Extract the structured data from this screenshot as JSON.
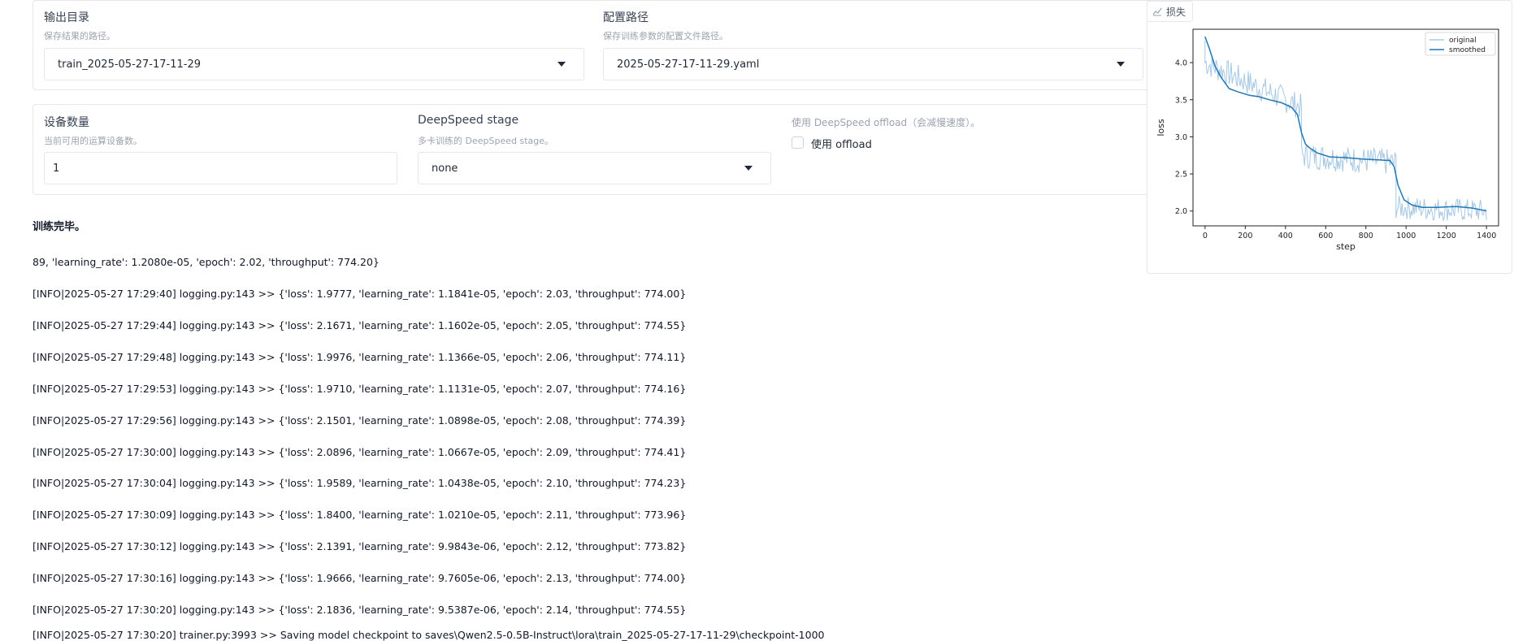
{
  "output_section": {
    "output_dir": {
      "label": "输出目录",
      "hint": "保存结果的路径。",
      "value": "train_2025-05-27-17-11-29"
    },
    "config_path": {
      "label": "配置路径",
      "hint": "保存训练参数的配置文件路径。",
      "value": "2025-05-27-17-11-29.yaml"
    }
  },
  "device_section": {
    "device_count": {
      "label": "设备数量",
      "hint": "当前可用的运算设备数。",
      "value": "1"
    },
    "ds_stage": {
      "label": "DeepSpeed stage",
      "hint": "多卡训练的 DeepSpeed stage。",
      "value": "none"
    },
    "ds_offload": {
      "hint": "使用 DeepSpeed offload（会减慢速度）。",
      "label": "使用 offload",
      "checked": false
    }
  },
  "status_text": "训练完毕。",
  "log_lines": [
    "89, 'learning_rate': 1.2080e-05, 'epoch': 2.02, 'throughput': 774.20}",
    "[INFO|2025-05-27 17:29:40] logging.py:143 >> {'loss': 1.9777, 'learning_rate': 1.1841e-05, 'epoch': 2.03, 'throughput': 774.00}",
    "[INFO|2025-05-27 17:29:44] logging.py:143 >> {'loss': 2.1671, 'learning_rate': 1.1602e-05, 'epoch': 2.05, 'throughput': 774.55}",
    "[INFO|2025-05-27 17:29:48] logging.py:143 >> {'loss': 1.9976, 'learning_rate': 1.1366e-05, 'epoch': 2.06, 'throughput': 774.11}",
    "[INFO|2025-05-27 17:29:53] logging.py:143 >> {'loss': 1.9710, 'learning_rate': 1.1131e-05, 'epoch': 2.07, 'throughput': 774.16}",
    "[INFO|2025-05-27 17:29:56] logging.py:143 >> {'loss': 2.1501, 'learning_rate': 1.0898e-05, 'epoch': 2.08, 'throughput': 774.39}",
    "[INFO|2025-05-27 17:30:00] logging.py:143 >> {'loss': 2.0896, 'learning_rate': 1.0667e-05, 'epoch': 2.09, 'throughput': 774.41}",
    "[INFO|2025-05-27 17:30:04] logging.py:143 >> {'loss': 1.9589, 'learning_rate': 1.0438e-05, 'epoch': 2.10, 'throughput': 774.23}",
    "[INFO|2025-05-27 17:30:09] logging.py:143 >> {'loss': 1.8400, 'learning_rate': 1.0210e-05, 'epoch': 2.11, 'throughput': 773.96}",
    "[INFO|2025-05-27 17:30:12] logging.py:143 >> {'loss': 2.1391, 'learning_rate': 9.9843e-06, 'epoch': 2.12, 'throughput': 773.82}",
    "[INFO|2025-05-27 17:30:16] logging.py:143 >> {'loss': 1.9666, 'learning_rate': 9.7605e-06, 'epoch': 2.13, 'throughput': 774.00}",
    "[INFO|2025-05-27 17:30:20] logging.py:143 >> {'loss': 2.1836, 'learning_rate': 9.5387e-06, 'epoch': 2.14, 'throughput': 774.55}",
    "[INFO|2025-05-27 17:30:20] trainer.py:3993 >> Saving model checkpoint to saves\\Qwen2.5-0.5B-Instruct\\lora\\train_2025-05-27-17-11-29\\checkpoint-1000"
  ],
  "plot_tab": {
    "label": "损失",
    "icon": "line-chart-icon"
  },
  "chart_data": {
    "type": "line",
    "title": "",
    "xlabel": "step",
    "ylabel": "loss",
    "xlim": [
      -60,
      1460
    ],
    "ylim": [
      1.8,
      4.45
    ],
    "xticks": [
      0,
      200,
      400,
      600,
      800,
      1000,
      1200,
      1400
    ],
    "yticks": [
      2.0,
      2.5,
      3.0,
      3.5,
      4.0
    ],
    "legend_position": "top-right",
    "series": [
      {
        "name": "original",
        "color": "#a6c8e4",
        "style": "noisy",
        "segments": [
          {
            "x0": 0,
            "x1": 480,
            "y0": 4.0,
            "y1": 3.4,
            "amp": 0.18
          },
          {
            "x0": 480,
            "x1": 950,
            "y0": 2.75,
            "y1": 2.65,
            "amp": 0.18
          },
          {
            "x0": 950,
            "x1": 1400,
            "y0": 2.05,
            "y1": 2.0,
            "amp": 0.16
          }
        ]
      },
      {
        "name": "smoothed",
        "color": "#1f77b4",
        "style": "smooth",
        "points": [
          [
            0,
            4.35
          ],
          [
            20,
            4.2
          ],
          [
            50,
            3.95
          ],
          [
            80,
            3.8
          ],
          [
            120,
            3.65
          ],
          [
            170,
            3.6
          ],
          [
            220,
            3.56
          ],
          [
            270,
            3.54
          ],
          [
            320,
            3.5
          ],
          [
            380,
            3.46
          ],
          [
            430,
            3.4
          ],
          [
            460,
            3.3
          ],
          [
            480,
            3.05
          ],
          [
            500,
            2.9
          ],
          [
            520,
            2.85
          ],
          [
            560,
            2.78
          ],
          [
            620,
            2.73
          ],
          [
            700,
            2.72
          ],
          [
            780,
            2.7
          ],
          [
            860,
            2.69
          ],
          [
            920,
            2.68
          ],
          [
            940,
            2.6
          ],
          [
            960,
            2.35
          ],
          [
            990,
            2.15
          ],
          [
            1030,
            2.08
          ],
          [
            1080,
            2.05
          ],
          [
            1150,
            2.05
          ],
          [
            1250,
            2.06
          ],
          [
            1330,
            2.04
          ],
          [
            1400,
            2.0
          ]
        ]
      }
    ]
  }
}
